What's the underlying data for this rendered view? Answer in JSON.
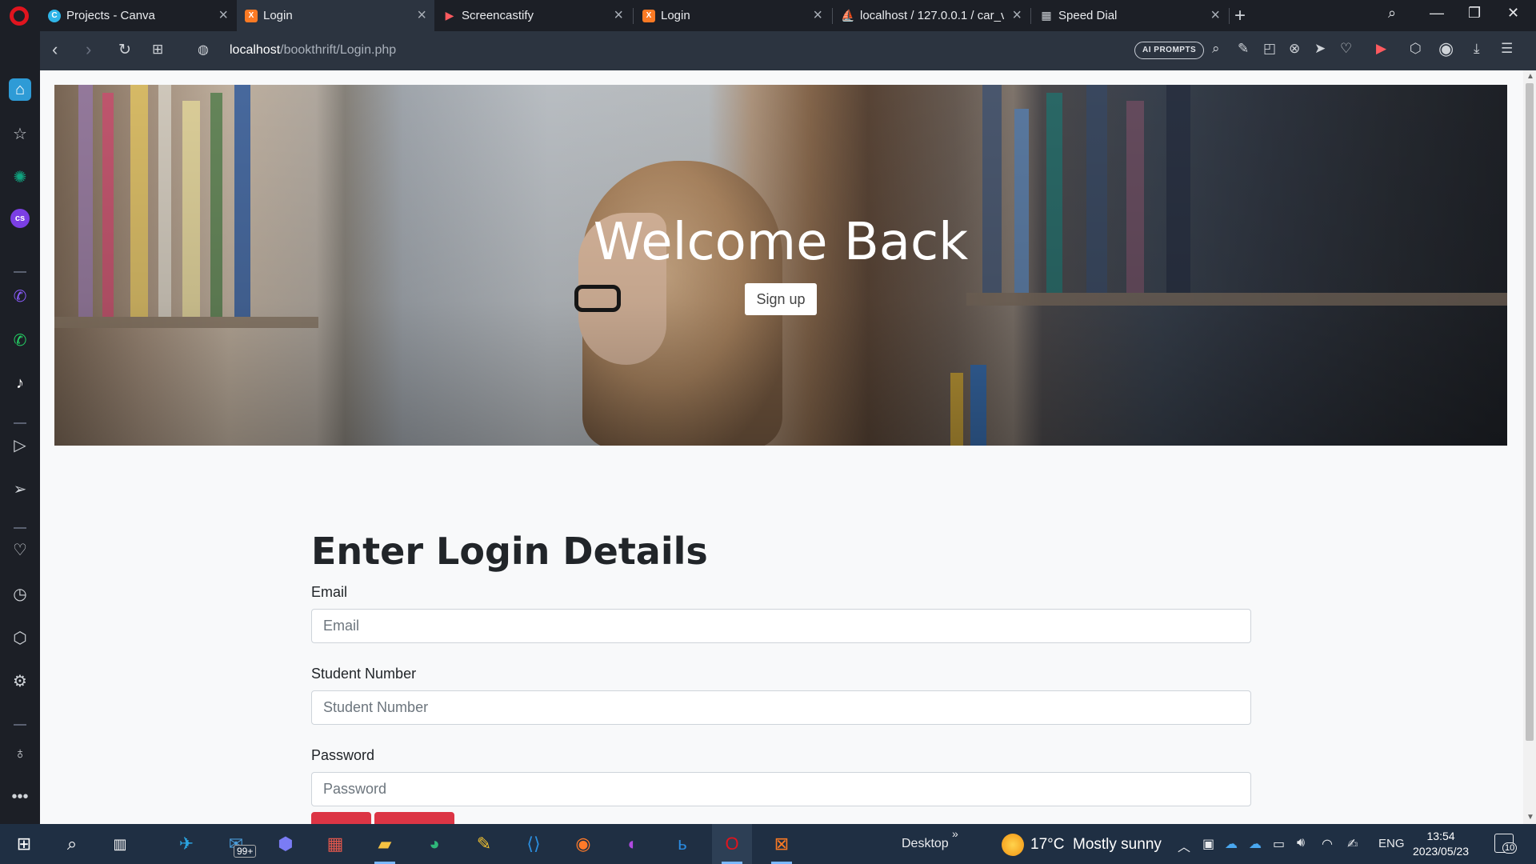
{
  "browser": {
    "tabs": [
      {
        "title": "Projects - Canva",
        "icon": "canva-icon",
        "color": "#6c5ce7"
      },
      {
        "title": "Login",
        "icon": "xampp-icon",
        "color": "#fb7a24",
        "active": true
      },
      {
        "title": "Screencastify",
        "icon": "screencastify-icon",
        "color": "#ff5a5f"
      },
      {
        "title": "Login",
        "icon": "xampp-icon",
        "color": "#fb7a24"
      },
      {
        "title": "localhost / 127.0.0.1 / car_v",
        "icon": "phpmyadmin-icon",
        "color": "#f29111"
      },
      {
        "title": "Speed Dial",
        "icon": "speed-dial-icon",
        "color": "#cfd3d8"
      }
    ],
    "url_host": "localhost",
    "url_path": "/bookthrift/Login.php",
    "ai_prompts_label": "AI PROMPTS"
  },
  "hero": {
    "title": "Welcome Back",
    "signup_label": "Sign up"
  },
  "form": {
    "title": "Enter Login Details",
    "email_label": "Email",
    "email_placeholder": "Email",
    "student_label": "Student Number",
    "student_placeholder": "Student Number",
    "password_label": "Password",
    "password_placeholder": "Password"
  },
  "taskbar": {
    "mail_badge": "99+",
    "desktop_label": "Desktop",
    "weather": "17°C  Mostly sunny",
    "language": "ENG",
    "time": "13:54",
    "date": "2023/05/23",
    "notifications": "10"
  },
  "colors": {
    "accent_red": "#dc3545",
    "opera_red": "#e0141e",
    "page_bg": "#f8f9fa"
  }
}
